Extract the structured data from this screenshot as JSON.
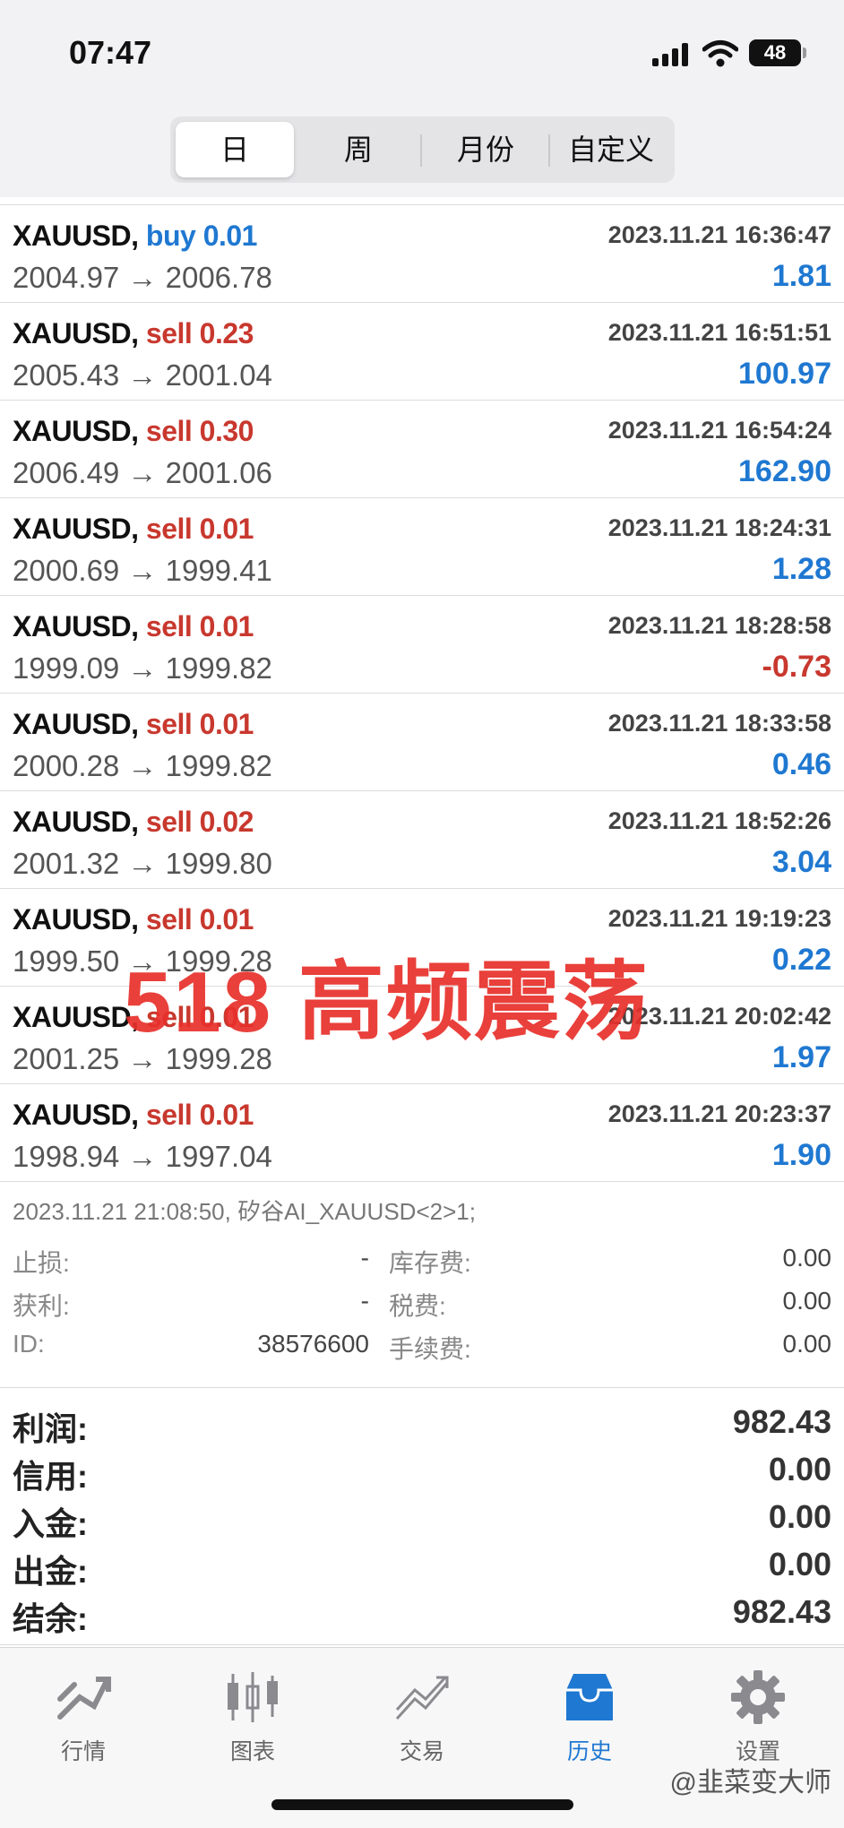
{
  "status": {
    "time": "07:47",
    "battery": "48"
  },
  "segments": [
    {
      "label": "日",
      "active": true
    },
    {
      "label": "周",
      "active": false
    },
    {
      "label": "月份",
      "active": false
    },
    {
      "label": "自定义",
      "active": false
    }
  ],
  "trades": [
    {
      "symbol": "XAUUSD,",
      "side": "buy 0.01",
      "type": "buy",
      "prices": "2004.97 → 2006.78",
      "datetime": "2023.11.21 16:36:47",
      "profit": "1.81",
      "sign": "pos"
    },
    {
      "symbol": "XAUUSD,",
      "side": "sell 0.23",
      "type": "sell",
      "prices": "2005.43 → 2001.04",
      "datetime": "2023.11.21 16:51:51",
      "profit": "100.97",
      "sign": "pos"
    },
    {
      "symbol": "XAUUSD,",
      "side": "sell 0.30",
      "type": "sell",
      "prices": "2006.49 → 2001.06",
      "datetime": "2023.11.21 16:54:24",
      "profit": "162.90",
      "sign": "pos"
    },
    {
      "symbol": "XAUUSD,",
      "side": "sell 0.01",
      "type": "sell",
      "prices": "2000.69 → 1999.41",
      "datetime": "2023.11.21 18:24:31",
      "profit": "1.28",
      "sign": "pos"
    },
    {
      "symbol": "XAUUSD,",
      "side": "sell 0.01",
      "type": "sell",
      "prices": "1999.09 → 1999.82",
      "datetime": "2023.11.21 18:28:58",
      "profit": "-0.73",
      "sign": "neg"
    },
    {
      "symbol": "XAUUSD,",
      "side": "sell 0.01",
      "type": "sell",
      "prices": "2000.28 → 1999.82",
      "datetime": "2023.11.21 18:33:58",
      "profit": "0.46",
      "sign": "pos"
    },
    {
      "symbol": "XAUUSD,",
      "side": "sell 0.02",
      "type": "sell",
      "prices": "2001.32 → 1999.80",
      "datetime": "2023.11.21 18:52:26",
      "profit": "3.04",
      "sign": "pos"
    },
    {
      "symbol": "XAUUSD,",
      "side": "sell 0.01",
      "type": "sell",
      "prices": "1999.50 → 1999.28",
      "datetime": "2023.11.21 19:19:23",
      "profit": "0.22",
      "sign": "pos"
    },
    {
      "symbol": "XAUUSD,",
      "side": "sell 0.01",
      "type": "sell",
      "prices": "2001.25 → 1999.28",
      "datetime": "2023.11.21 20:02:42",
      "profit": "1.97",
      "sign": "pos"
    },
    {
      "symbol": "XAUUSD,",
      "side": "sell 0.01",
      "type": "sell",
      "prices": "1998.94 → 1997.04",
      "datetime": "2023.11.21 20:23:37",
      "profit": "1.90",
      "sign": "pos"
    }
  ],
  "detail": {
    "header": "2023.11.21 21:08:50, 矽谷AI_XAUUSD<2>1;",
    "stoploss_label": "止损:",
    "stoploss_value": "-",
    "takeprofit_label": "获利:",
    "takeprofit_value": "-",
    "id_label": "ID:",
    "id_value": "38576600",
    "swap_label": "库存费:",
    "swap_value": "0.00",
    "tax_label": "税费:",
    "tax_value": "0.00",
    "fee_label": "手续费:",
    "fee_value": "0.00"
  },
  "summary": [
    {
      "label": "利润:",
      "value": "982.43"
    },
    {
      "label": "信用:",
      "value": "0.00"
    },
    {
      "label": "入金:",
      "value": "0.00"
    },
    {
      "label": "出金:",
      "value": "0.00"
    },
    {
      "label": "结余:",
      "value": "982.43"
    }
  ],
  "overlay_text": "518 高频震荡",
  "tabs": [
    {
      "label": "行情",
      "icon": "quotes-icon",
      "active": false
    },
    {
      "label": "图表",
      "icon": "chart-icon",
      "active": false
    },
    {
      "label": "交易",
      "icon": "trade-icon",
      "active": false
    },
    {
      "label": "历史",
      "icon": "history-icon",
      "active": true
    },
    {
      "label": "设置",
      "icon": "settings-icon",
      "active": false
    }
  ],
  "watermark": "@韭菜变大师",
  "colors": {
    "accent": "#1f78d1",
    "negative": "#c8382e",
    "overlay": "#e8302b"
  }
}
